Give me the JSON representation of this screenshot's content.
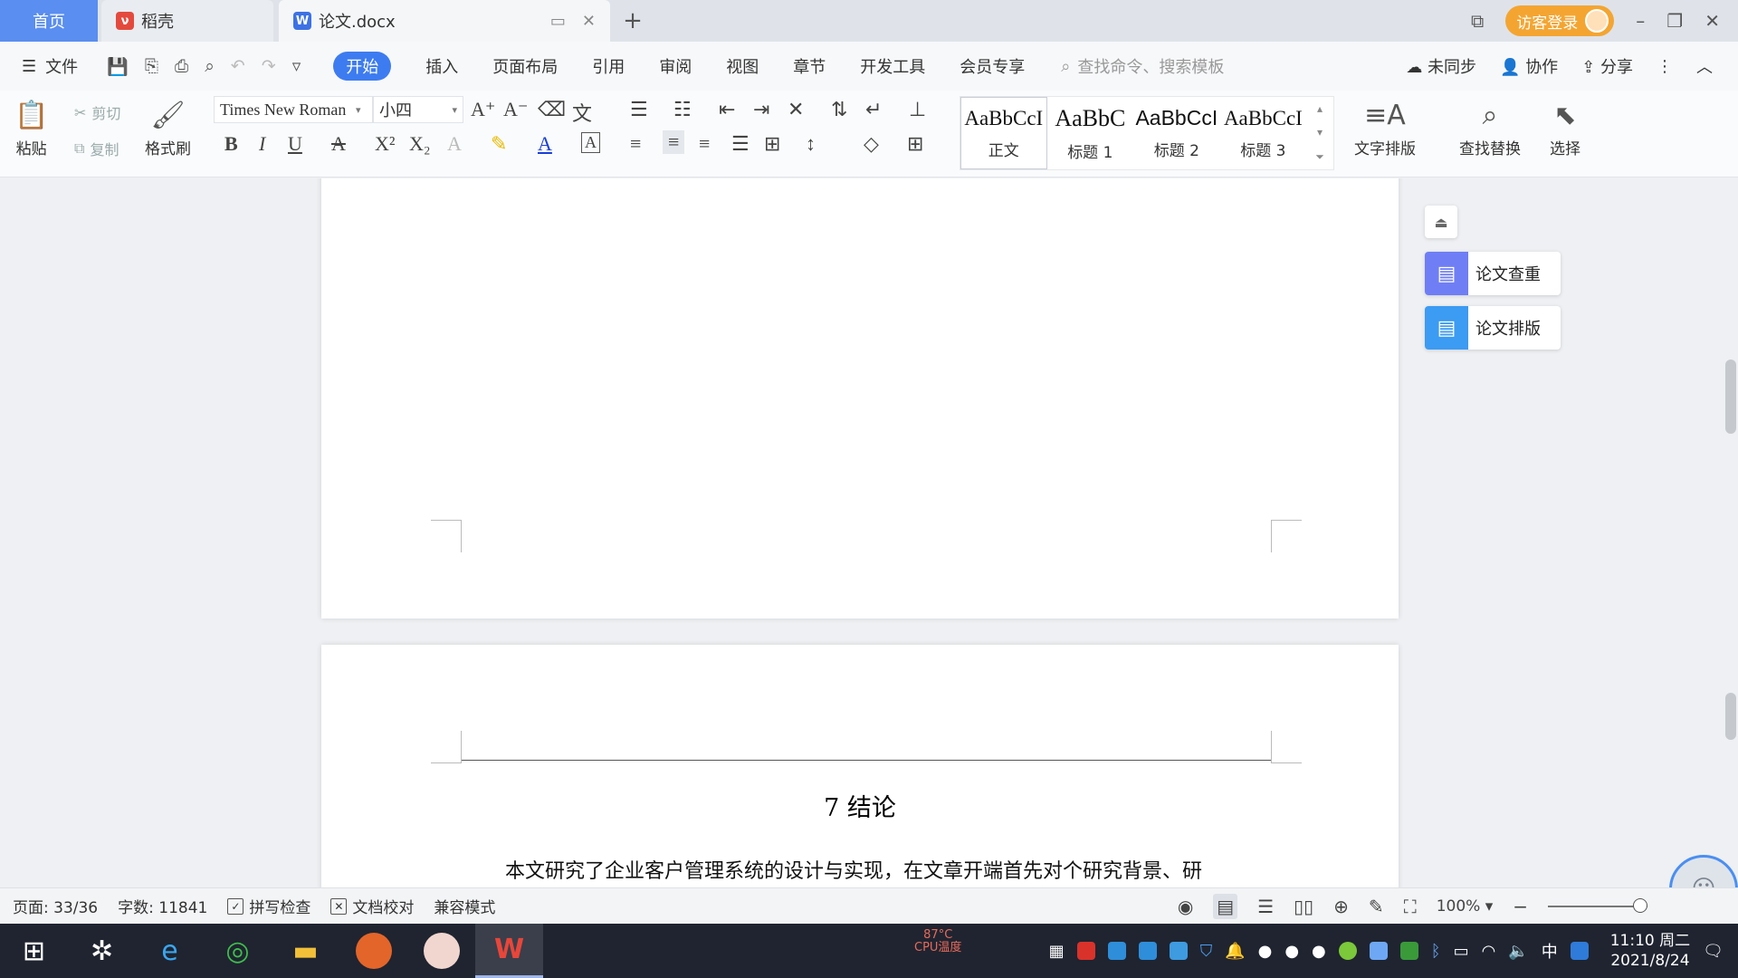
{
  "tabs": {
    "home": "首页",
    "daoke": "稻壳",
    "doc": "论文.docx",
    "new_tab": "+"
  },
  "titlebar": {
    "login": "访客登录",
    "minimize": "–",
    "restore": "❐",
    "close": "✕"
  },
  "menubar": {
    "file": "文件",
    "items": [
      "开始",
      "插入",
      "页面布局",
      "引用",
      "审阅",
      "视图",
      "章节",
      "开发工具",
      "会员专享"
    ],
    "search_placeholder": "查找命令、搜索模板",
    "unsynced": "未同步",
    "collaborate": "协作",
    "share": "分享"
  },
  "ribbon": {
    "paste": "粘贴",
    "cut": "剪切",
    "copy": "复制",
    "format_painter": "格式刷",
    "font_name": "Times New Roman",
    "font_size": "小四",
    "styles": [
      {
        "sample": "AaBbCcI",
        "name": "正文"
      },
      {
        "sample": "AaBbC",
        "name": "标题 1"
      },
      {
        "sample": "AaBbCcI",
        "name": "标题 2"
      },
      {
        "sample": "AaBbCcI",
        "name": "标题 3"
      }
    ],
    "text_layout": "文字排版",
    "find_replace": "查找替换",
    "select": "选择"
  },
  "side_panel": {
    "check": "论文查重",
    "layout": "论文排版"
  },
  "document": {
    "heading": "7  结论",
    "paragraph": "本文研究了企业客户管理系统的设计与实现，在文章开端首先对个研究背景、研"
  },
  "statusbar": {
    "page": "页面: 33/36",
    "words": "字数: 11841",
    "spellcheck": "拼写检查",
    "proofread": "文档校对",
    "compat": "兼容模式",
    "zoom": "100%"
  },
  "taskbar": {
    "temp_value": "87°C",
    "temp_label": "CPU温度",
    "ime": "中",
    "time": "11:10 周二",
    "date": "2021/8/24"
  },
  "colors": {
    "accent": "#3d7cf0",
    "home_tab": "#5a8ef0",
    "login": "#f4a531"
  }
}
